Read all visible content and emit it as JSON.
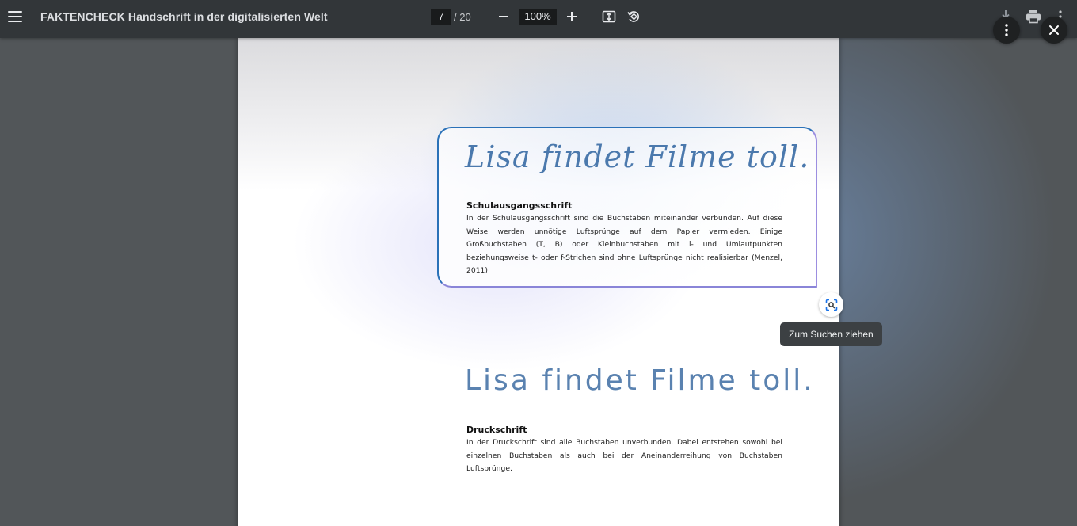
{
  "toolbar": {
    "title": "FAKTENCHECK Handschrift in der digitalisierten Welt",
    "current_page": "7",
    "total_pages": "/ 20",
    "zoom": "100%",
    "icons": [
      "menu-icon",
      "zoom-out-icon",
      "zoom-in-icon",
      "fit-page-icon",
      "rotate-icon",
      "download-icon",
      "print-icon",
      "more-vert-icon"
    ]
  },
  "document": {
    "section1": {
      "sample": "Lisa findet Filme toll.",
      "heading": "Schulausgangsschrift",
      "body": "In der Schulausgangsschrift sind die Buchstaben miteinander verbunden. Auf diese Weise werden unnötige Luftsprünge auf dem Papier vermieden. Einige Großbuchstaben (T, B) oder Kleinbuchstaben mit i- und Umlautpunkten beziehungsweise t- oder f-Strichen sind ohne Luftsprünge nicht realisierbar (Menzel, 2011)."
    },
    "section2": {
      "sample": "Lisa findet Filme toll.",
      "heading": "Druckschrift",
      "body": "In der Druckschrift sind alle Buchstaben unverbunden. Dabei entstehen sowohl bei einzelnen Buchstaben als auch bei der Aneinanderreihung von Buchstaben Luftsprünge."
    }
  },
  "lens": {
    "tooltip": "Zum Suchen ziehen",
    "icon": "lens-search-icon"
  },
  "overlay_buttons": {
    "more_icon": "more-vert-icon",
    "close_icon": "close-icon"
  },
  "colors": {
    "toolbar_bg": "#323639",
    "viewer_bg": "#525659",
    "card_border": "#2a71b8",
    "script_ink": "#4b79ad"
  }
}
